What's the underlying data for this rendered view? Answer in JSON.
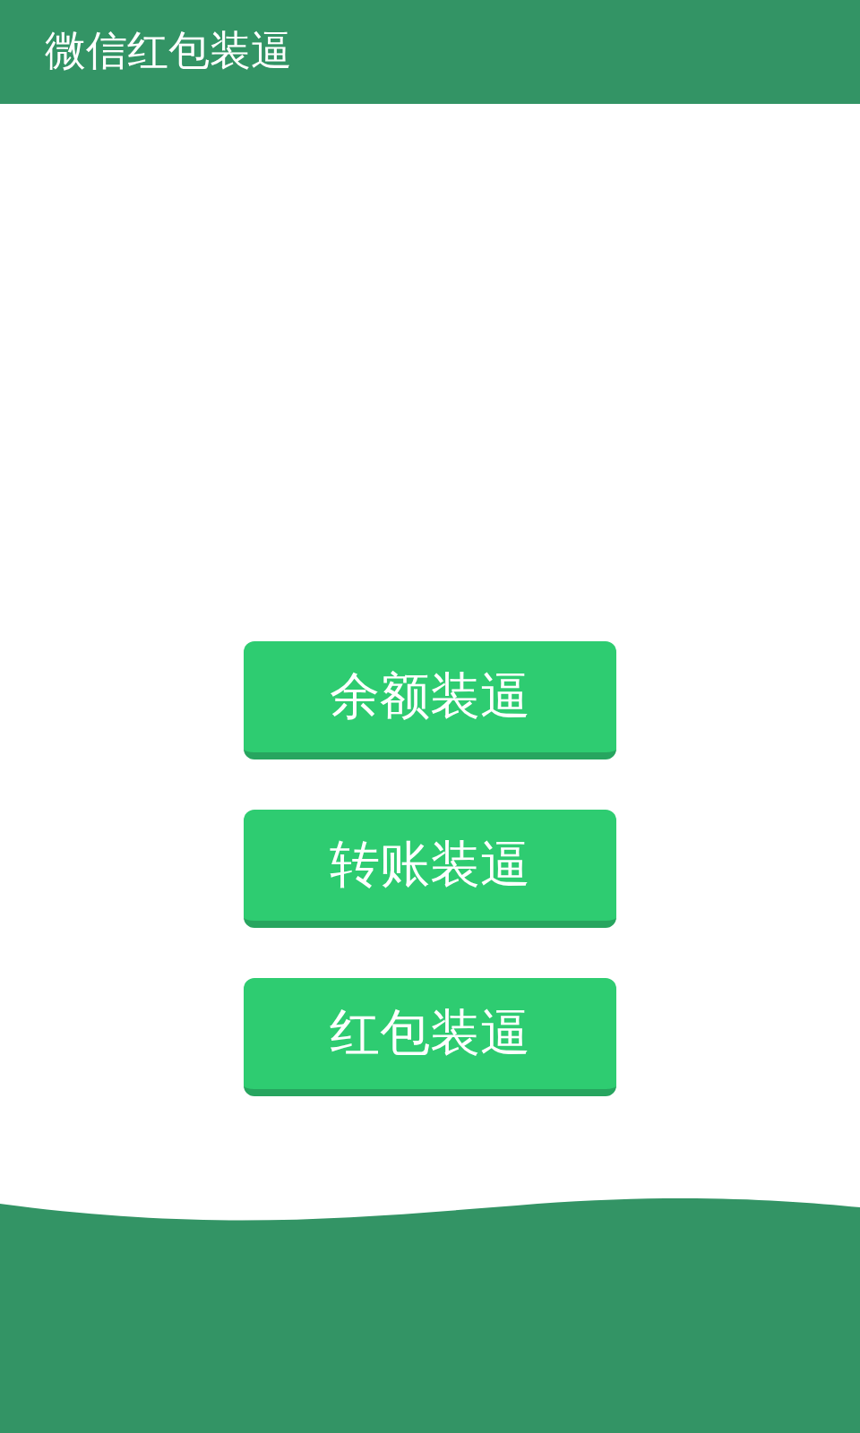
{
  "app_bar": {
    "title": "微信红包装逼"
  },
  "buttons": [
    {
      "label": "余额装逼"
    },
    {
      "label": "转账装逼"
    },
    {
      "label": "红包装逼"
    }
  ]
}
